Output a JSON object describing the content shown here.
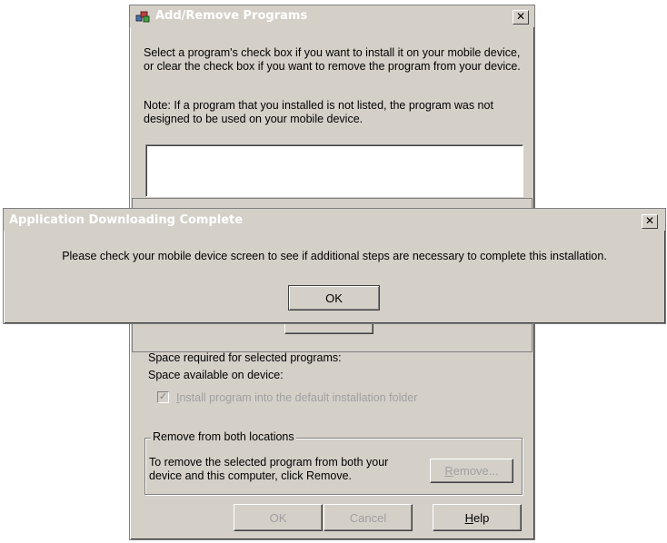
{
  "add_remove": {
    "title": "Add/Remove Programs",
    "close_glyph": "✕",
    "intro_text": "Select a program's check box if you want to install it on your mobile device, or clear the check box if you want to remove the program from your device.",
    "note_text": "Note:  If a program that you installed is not listed, the program was not designed to be used on your mobile device.",
    "space_required_label": "Space required for selected programs:",
    "space_available_label": "Space available on device:",
    "install_default_prefix": "I",
    "install_default_rest": "nstall program into the default installation folder",
    "install_default_checked": true,
    "remove_group_label": "Remove from both locations",
    "remove_text": "To remove the selected program from both your device and this computer, click Remove.",
    "remove_button_prefix": "R",
    "remove_button_rest": "emove...",
    "ok_label": "OK",
    "cancel_label": "Cancel",
    "help_prefix": "H",
    "help_rest": "elp"
  },
  "dialog": {
    "title": "Application Downloading Complete",
    "close_glyph": "✕",
    "message": "Please check your mobile device screen to see if additional steps are necessary to complete this installation.",
    "ok_label": "OK"
  },
  "icons": {
    "app_icon": "programs-icon"
  }
}
